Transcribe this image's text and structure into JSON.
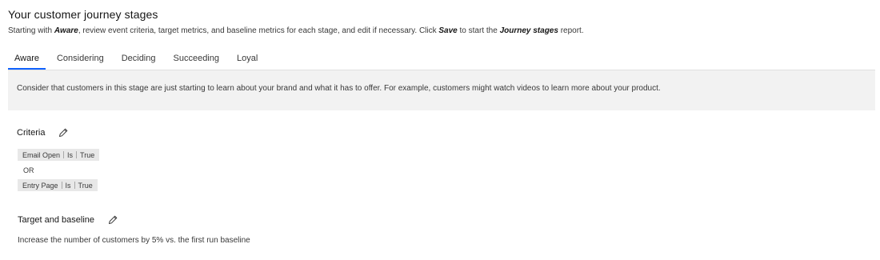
{
  "header": {
    "title": "Your customer journey stages",
    "subtitle_parts": {
      "p1": "Starting with ",
      "b1": "Aware",
      "p2": ", review event criteria, target metrics, and baseline metrics for each stage, and edit if necessary. Click ",
      "b2": "Save",
      "p3": " to start the ",
      "b3": "Journey stages",
      "p4": " report."
    }
  },
  "tabs": [
    {
      "label": "Aware",
      "active": true
    },
    {
      "label": "Considering",
      "active": false
    },
    {
      "label": "Deciding",
      "active": false
    },
    {
      "label": "Succeeding",
      "active": false
    },
    {
      "label": "Loyal",
      "active": false
    }
  ],
  "stage": {
    "description": "Consider that customers in this stage are just starting to learn about your brand and what it has to offer. For example, customers might watch videos to learn more about your product."
  },
  "criteria": {
    "heading": "Criteria",
    "edit_icon": "edit-icon",
    "rules": [
      {
        "field": "Email Open",
        "operator": "Is",
        "value": "True"
      },
      {
        "field": "Entry Page",
        "operator": "Is",
        "value": "True"
      }
    ],
    "connector": "OR"
  },
  "target": {
    "heading": "Target and baseline",
    "edit_icon": "edit-icon",
    "text": "Increase the number of customers by 5% vs. the first run baseline"
  },
  "colors": {
    "accent": "#0f62fe",
    "panel_bg": "#f2f2f2",
    "chip_bg": "#e8e8e8"
  }
}
